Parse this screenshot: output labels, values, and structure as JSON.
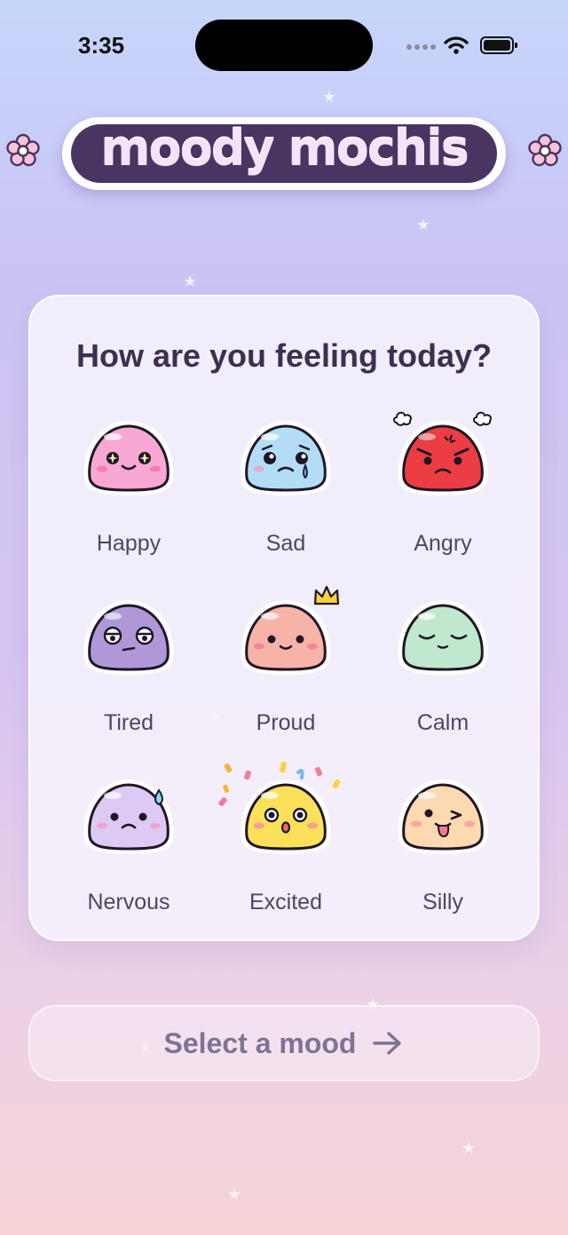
{
  "status": {
    "time": "3:35"
  },
  "app": {
    "title": "moody mochis"
  },
  "card": {
    "title": "How are you feeling today?"
  },
  "moods": [
    {
      "label": "Happy",
      "color": "#f8a8d2",
      "icon": "happy-mochi-icon"
    },
    {
      "label": "Sad",
      "color": "#b3ddf6",
      "icon": "sad-mochi-icon"
    },
    {
      "label": "Angry",
      "color": "#ec3d44",
      "icon": "angry-mochi-icon"
    },
    {
      "label": "Tired",
      "color": "#b098d8",
      "icon": "tired-mochi-icon"
    },
    {
      "label": "Proud",
      "color": "#f7b3a8",
      "icon": "proud-mochi-icon"
    },
    {
      "label": "Calm",
      "color": "#bfe8cf",
      "icon": "calm-mochi-icon"
    },
    {
      "label": "Nervous",
      "color": "#dccaf4",
      "icon": "nervous-mochi-icon"
    },
    {
      "label": "Excited",
      "color": "#fbe15a",
      "icon": "excited-mochi-icon"
    },
    {
      "label": "Silly",
      "color": "#fcd9b0",
      "icon": "silly-mochi-icon"
    }
  ],
  "cta": {
    "label": "Select a mood"
  }
}
